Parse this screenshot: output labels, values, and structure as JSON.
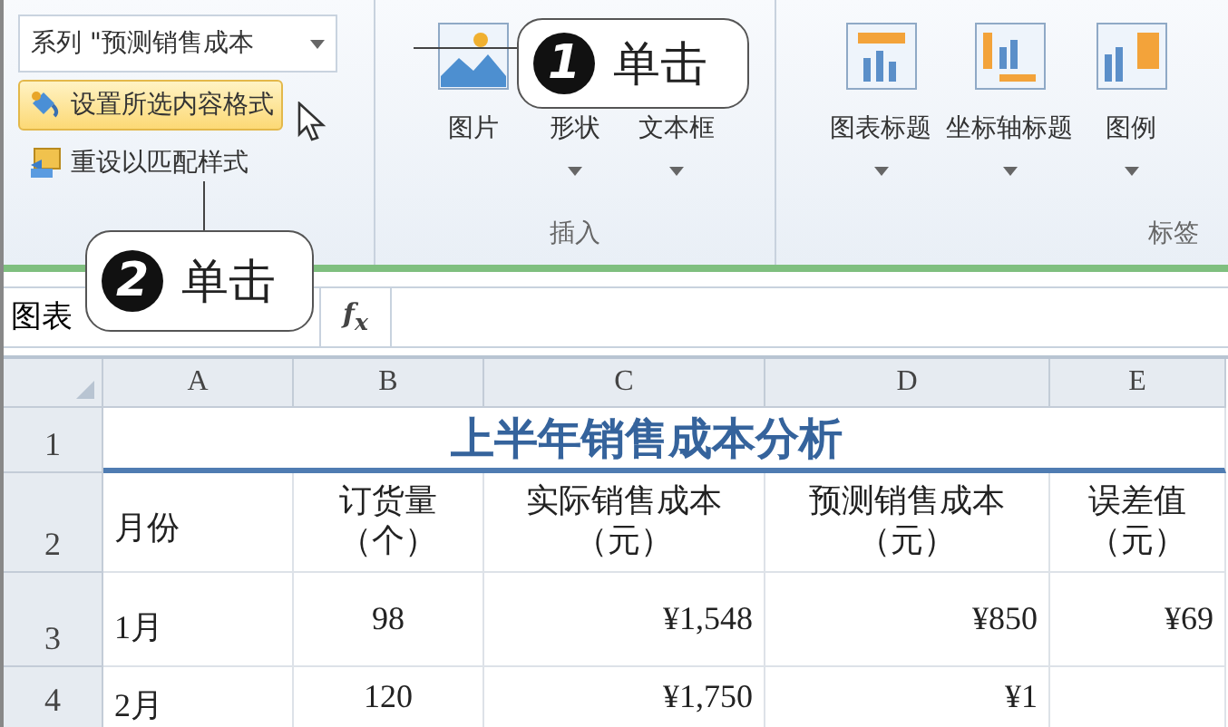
{
  "ribbon": {
    "series_dropdown": {
      "value": "系列 \"预测销售成本"
    },
    "commands": [
      {
        "kind": "format",
        "label": "设置所选内容格式",
        "highlighted": true
      },
      {
        "kind": "reset",
        "label": "重设以匹配样式",
        "highlighted": false
      }
    ],
    "groups": [
      {
        "label": "插入",
        "buttons": [
          {
            "kind": "picture",
            "label": "图片",
            "dropdown": false
          },
          {
            "kind": "shape",
            "label": "形状",
            "dropdown": true
          },
          {
            "kind": "textbox",
            "label": "文本框",
            "dropdown": true
          }
        ]
      },
      {
        "label": "标签",
        "buttons": [
          {
            "kind": "chart_title",
            "label": "图表标题",
            "dropdown": true
          },
          {
            "kind": "axis_title",
            "label": "坐标轴标题",
            "dropdown": true
          },
          {
            "kind": "legend",
            "label": "图例",
            "dropdown": true
          }
        ]
      }
    ]
  },
  "formula_bar": {
    "name_box": "图表",
    "fx": "f$_{x}$"
  },
  "sheet": {
    "columns": [
      "A",
      "B",
      "C",
      "D",
      "E"
    ],
    "rows": [
      {
        "number": "1",
        "kind": "title",
        "cells": [
          "",
          "",
          "上半年销售成本分析"
        ]
      },
      {
        "number": "2",
        "kind": "header",
        "cells": [
          [
            "月份"
          ],
          [
            "订货量",
            "（个）"
          ],
          [
            "实际销售成本",
            "（元）"
          ],
          [
            "预测销售成本",
            "（元）"
          ],
          [
            "误差值",
            "（元）"
          ]
        ]
      },
      {
        "number": "3",
        "kind": "data",
        "cells": [
          "1月",
          "98",
          "¥1,548",
          "¥850",
          "¥69"
        ]
      },
      {
        "number": "4",
        "kind": "data",
        "cells": [
          "2月",
          "120",
          "¥1,750",
          "¥1",
          ""
        ]
      }
    ]
  },
  "callouts": [
    {
      "number": "1",
      "text": "单击"
    },
    {
      "number": "2",
      "text": "单击"
    }
  ]
}
